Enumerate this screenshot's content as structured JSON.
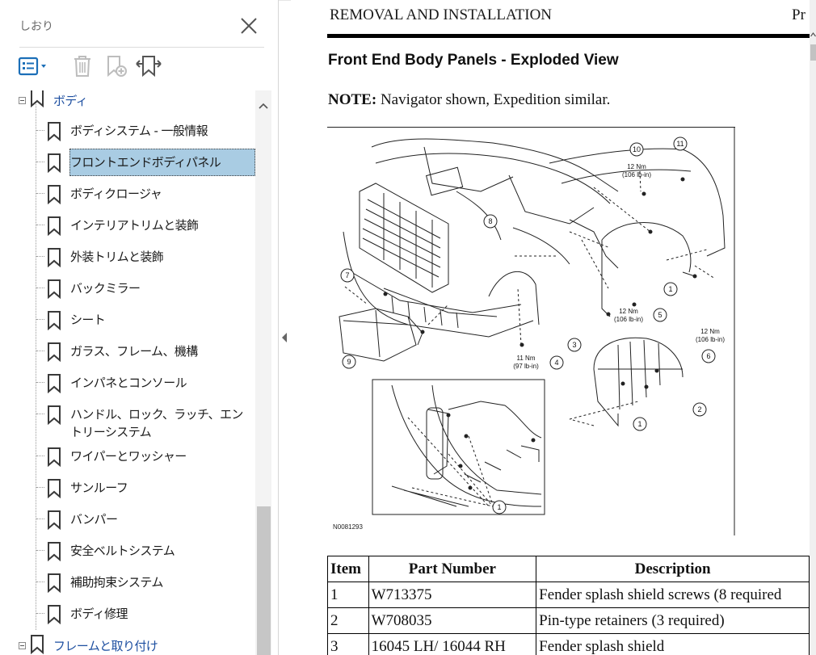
{
  "sidebar": {
    "title": "しおり",
    "close_icon": "close-icon",
    "toolbar": [
      {
        "name": "options-menu-button",
        "icon": "list-options-icon",
        "color": "#1c6fb8"
      },
      {
        "name": "delete-bookmark-button",
        "icon": "trash-icon"
      },
      {
        "name": "new-bookmark-button",
        "icon": "add-bookmark-icon"
      },
      {
        "name": "expand-bookmark-button",
        "icon": "bookmark-expand-icon"
      }
    ],
    "parent_node": "ボディ",
    "items": [
      {
        "label": "ボディシステム - 一般情報"
      },
      {
        "label": "フロントエンドボディパネル",
        "selected": true
      },
      {
        "label": "ボディクロージャ"
      },
      {
        "label": "インテリアトリムと装飾"
      },
      {
        "label": "外装トリムと装飾"
      },
      {
        "label": "バックミラー"
      },
      {
        "label": "シート"
      },
      {
        "label": "ガラス、フレーム、機構"
      },
      {
        "label": "インパネとコンソール"
      },
      {
        "label": "ハンドル、ロック、ラッチ、エントリーシステム"
      },
      {
        "label": "ワイパーとワッシャー"
      },
      {
        "label": "サンルーフ"
      },
      {
        "label": "バンパー"
      },
      {
        "label": "安全ベルトシステム"
      },
      {
        "label": "補助拘束システム"
      },
      {
        "label": "ボディ修理"
      }
    ],
    "next_node": "フレームと取り付け",
    "selection_color": "#a9cce3",
    "link_color": "#1c4ea0"
  },
  "document": {
    "header_left": "REMOVAL AND INSTALLATION",
    "header_right": "Pr",
    "section_title": "Front End Body Panels - Exploded View",
    "note_label": "NOTE:",
    "note_text": " Navigator shown, Expedition similar.",
    "figure": {
      "id": "N0081293",
      "callouts": [
        "1",
        "2",
        "3",
        "4",
        "5",
        "6",
        "7",
        "8",
        "9",
        "10",
        "11"
      ],
      "torque_labels": {
        "t10_a": "12 Nm",
        "t10_b": "(106 lb-in)",
        "t5_a": "12 Nm",
        "t5_b": "(106 lb-in)",
        "t6_a": "12 Nm",
        "t6_b": "(106 lb-in)",
        "t4_a": "11 Nm",
        "t4_b": "(97 lb-in)"
      }
    },
    "table": {
      "headers": [
        "Item",
        "Part Number",
        "Description"
      ],
      "rows": [
        [
          "1",
          "W713375",
          "Fender splash shield screws (8 required"
        ],
        [
          "2",
          "W708035",
          "Pin-type retainers (3 required)"
        ],
        [
          "3",
          "16045 LH/ 16044 RH",
          "Fender splash shield"
        ]
      ]
    }
  }
}
